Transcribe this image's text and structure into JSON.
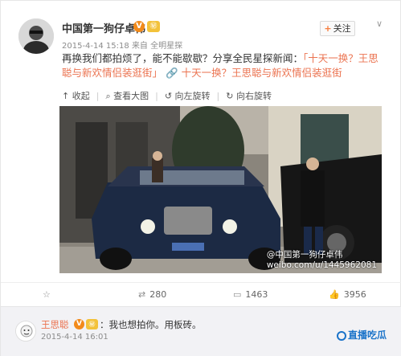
{
  "post": {
    "username": "中国第一狗仔卓伟",
    "verified_badge": "V",
    "level_badge": "㊙",
    "follow_label": "关注",
    "follow_plus": "+",
    "chevron": "∨",
    "timestamp": "2015-4-14 15:18",
    "source": "来自 全明星探",
    "text_plain": "再换我们都拍烦了，能不能歇歇？分享全民星探新闻：",
    "text_link": "「十天一换？王思聪与新欢情侣装逛街」",
    "link_icon": "🔗",
    "link_title": "十天一换？王思聪与新欢情侣装逛街"
  },
  "toolbar": {
    "collect": "收起",
    "view_large": "查看大图",
    "rotate_left": "向左旋转",
    "rotate_right": "向右旋转",
    "icons": [
      "collapse-icon",
      "zoom-icon",
      "rotate-left-icon",
      "rotate-right-icon"
    ]
  },
  "photo": {
    "watermark": "@中国第一狗仔卓伟",
    "watermark_url": "weibo.com/u/1445962081"
  },
  "actions": {
    "repost_count": "280",
    "comment_count": "1463",
    "like_count": "3956"
  },
  "comment": {
    "name": "王思聪",
    "verified_badge": "V",
    "level_badge": "㊙",
    "text": "：我也想拍你。用板砖。",
    "time": "2015-4-14 16:01",
    "logo_text": "直播吃瓜"
  },
  "colors": {
    "link": "#eb7350",
    "verified": "#f28a1a",
    "comment_bg": "#f2f2f5"
  }
}
